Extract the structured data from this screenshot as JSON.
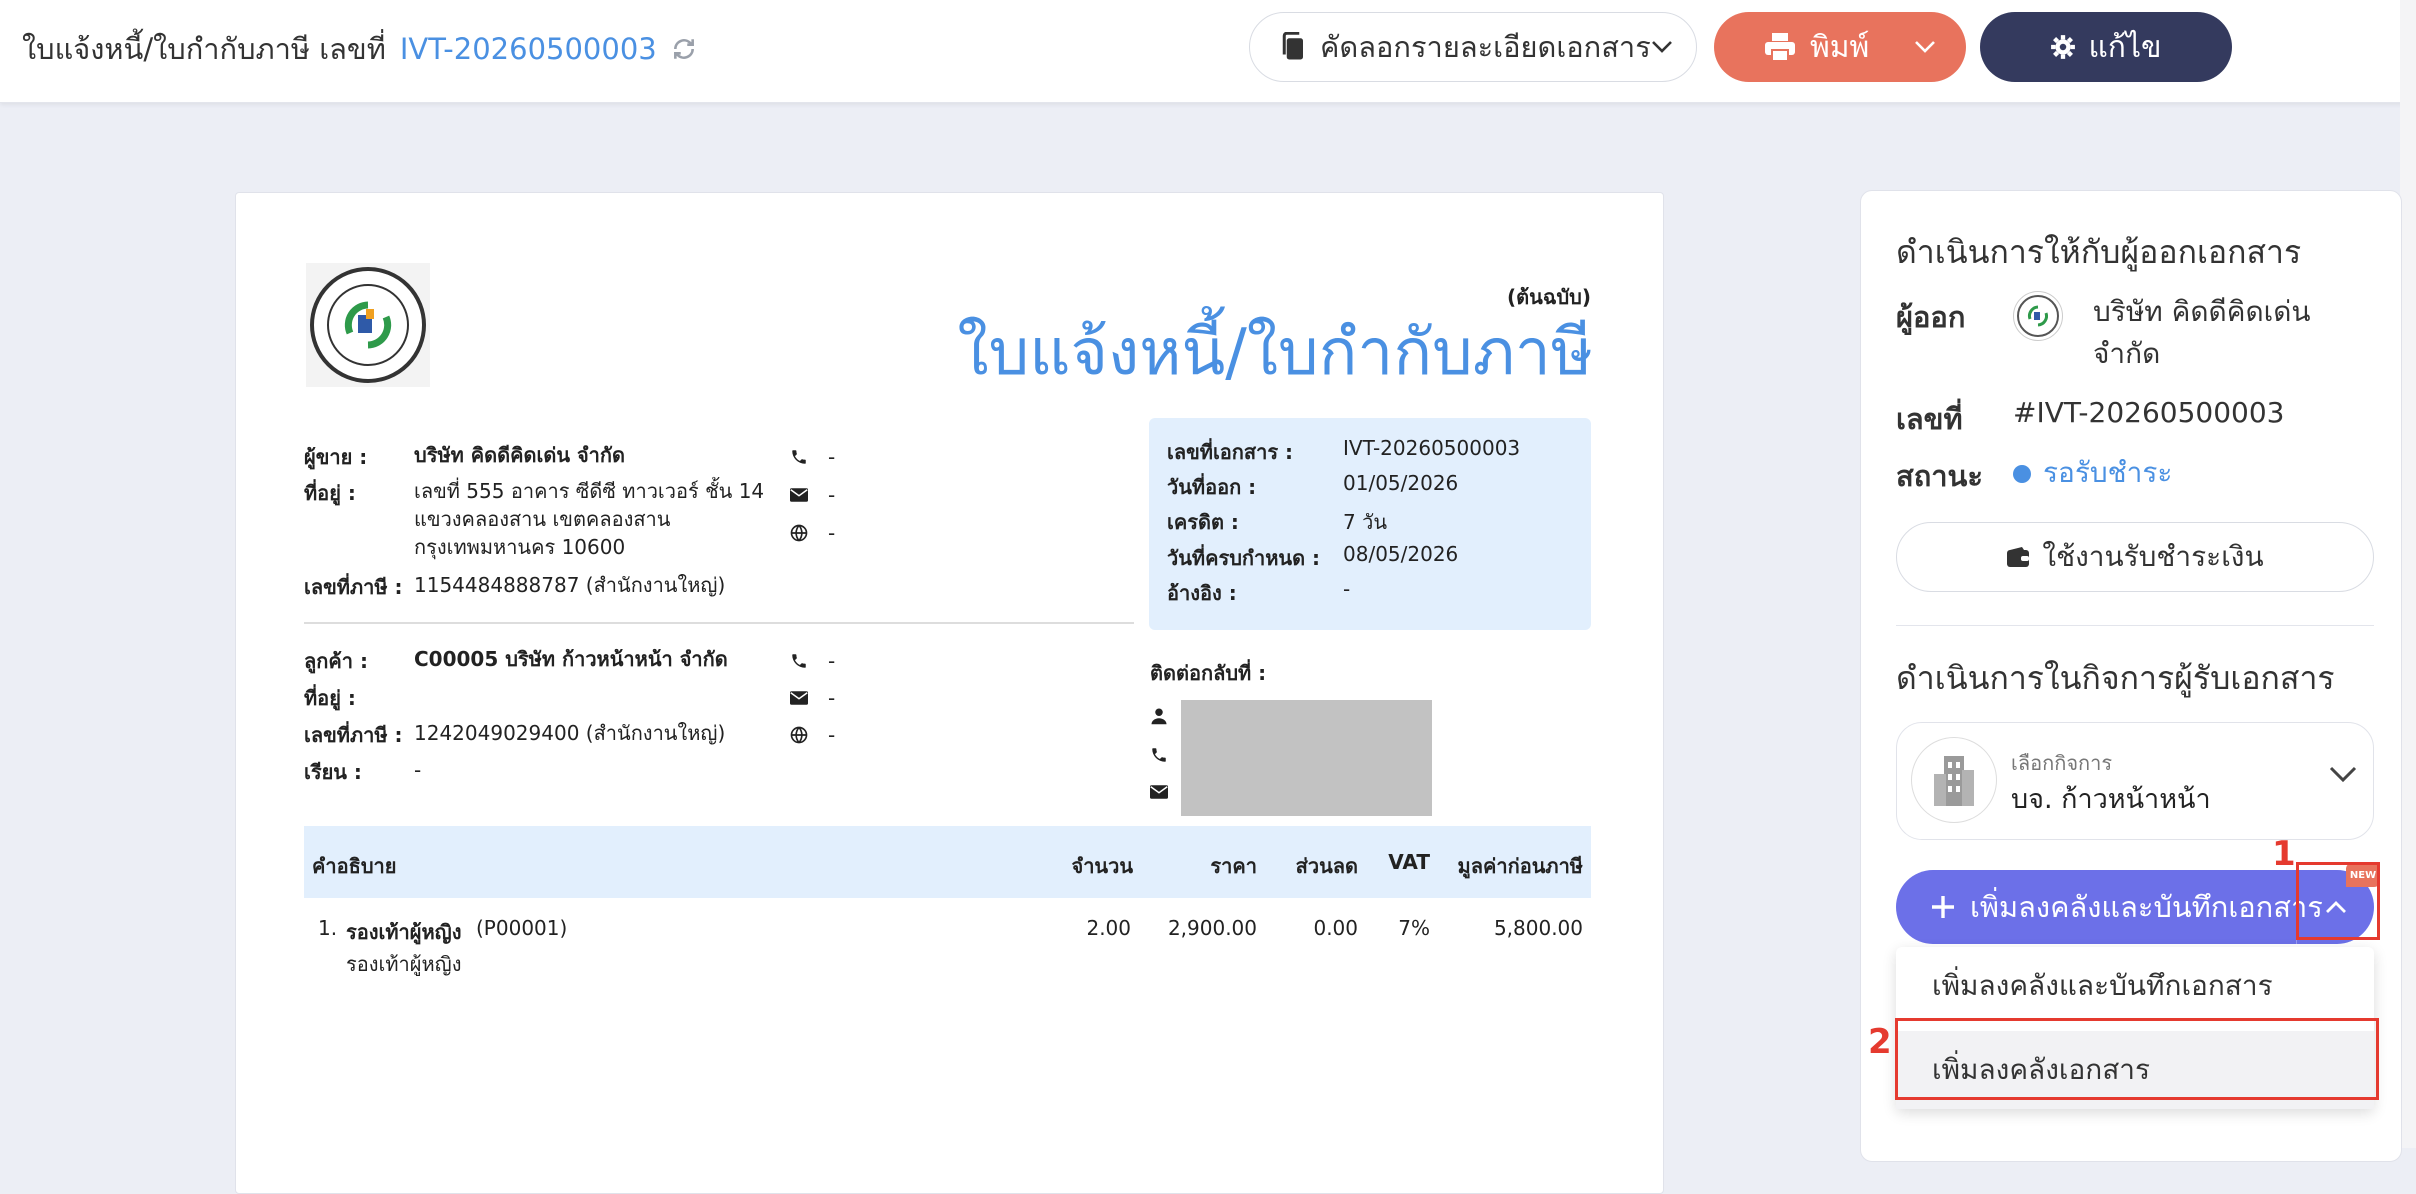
{
  "topbar": {
    "title": "ใบแจ้งหนี้/ใบกำกับภาษี เลขที่",
    "doc_no": "IVT-20260500003",
    "copy_label": "คัดลอกรายละเอียดเอกสาร",
    "print_label": "พิมพ์",
    "edit_label": "แก้ไข"
  },
  "document": {
    "copy_tag": "(ต้นฉบับ)",
    "title": "ใบแจ้งหนี้/ใบกำกับภาษี",
    "seller": {
      "label": "ผู้ขาย :",
      "name": "บริษัท คิดดีคิดเด่น จำกัด",
      "address_label": "ที่อยู่ :",
      "address_1": "เลขที่ 555 อาคาร ซีดีซี ทาวเวอร์ ชั้น 14",
      "address_2": "แขวงคลองสาน เขตคลองสาน",
      "address_3": "กรุงเทพมหานคร 10600",
      "tax_label": "เลขที่ภาษี :",
      "tax_id": "1154484888787 (สำนักงานใหญ่)",
      "phone": "-",
      "email": "-",
      "web": "-"
    },
    "customer": {
      "label": "ลูกค้า :",
      "name": "C00005 บริษัท ก้าวหน้าหน้า จำกัด",
      "address_label": "ที่อยู่ :",
      "tax_label": "เลขที่ภาษี :",
      "tax_id": "1242049029400 (สำนักงานใหญ่)",
      "attn_label": "เรียน :",
      "attn": "-",
      "phone": "-",
      "email": "-",
      "web": "-"
    },
    "info": {
      "docno_label": "เลขที่เอกสาร :",
      "docno": "IVT-20260500003",
      "issue_label": "วันที่ออก :",
      "issue": "01/05/2026",
      "credit_label": "เครดิต :",
      "credit": "7 วัน",
      "due_label": "วันที่ครบกำหนด :",
      "due": "08/05/2026",
      "ref_label": "อ้างอิง :",
      "ref": "-"
    },
    "contact_back_label": "ติดต่อกลับที่ :",
    "table": {
      "headers": [
        "คำอธิบาย",
        "จำนวน",
        "ราคา",
        "ส่วนลด",
        "VAT",
        "มูลค่าก่อนภาษี"
      ],
      "rows": [
        {
          "no": "1.",
          "name": "รองเท้าผู้หญิง",
          "code": "(P00001)",
          "desc": "รองเท้าผู้หญิง",
          "qty": "2.00",
          "price": "2,900.00",
          "discount": "0.00",
          "vat": "7%",
          "amount": "5,800.00"
        }
      ]
    }
  },
  "panel": {
    "issuer_heading": "ดำเนินการให้กับผู้ออกเอกสาร",
    "issuer_label": "ผู้ออก",
    "issuer_name_1": "บริษัท คิดดีคิดเด่น",
    "issuer_name_2": "จำกัด",
    "docno_label": "เลขที่",
    "docno": "#IVT-20260500003",
    "status_label": "สถานะ",
    "status": "รอรับชำระ",
    "status_color": "#4a90e2",
    "pay_button": "ใช้งานรับชำระเงิน",
    "receiver_heading": "ดำเนินการในกิจการผู้รับเอกสาร",
    "biz_select_label": "เลือกกิจการ",
    "biz_select_value": "บจ. ก้าวหน้าหน้า",
    "add_button": "เพิ่มลงคลังและบันทึกเอกสาร",
    "new_badge": "NEW",
    "menu_items": [
      "เพิ่มลงคลังและบันทึกเอกสาร",
      "เพิ่มลงคลังเอกสาร"
    ]
  },
  "annotations": {
    "step1": "1",
    "step2": "2"
  },
  "colors": {
    "accent": "#4a90e2",
    "print": "#e8735d",
    "edit": "#343a5e",
    "add": "#6c70e8",
    "annotation": "#e53a2f"
  }
}
